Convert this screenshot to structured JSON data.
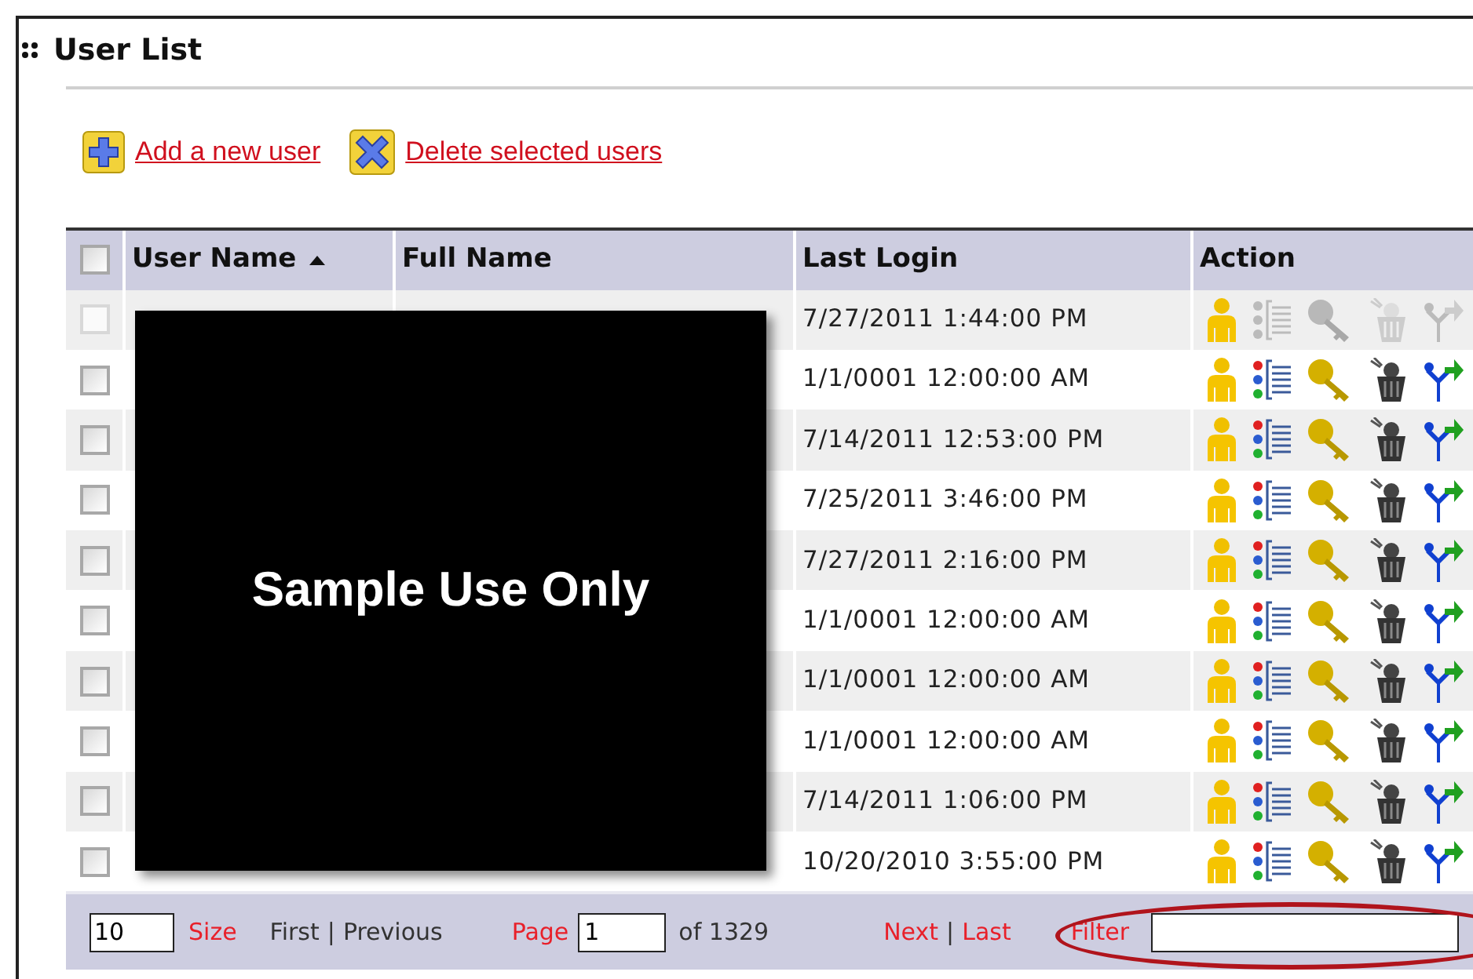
{
  "title": "User List",
  "actions": [
    {
      "kind": "add",
      "label": "Add a new user"
    },
    {
      "kind": "delete",
      "label": "Delete selected users"
    }
  ],
  "table": {
    "select_all": {
      "checked": false
    },
    "columns": [
      {
        "label": "User Name",
        "sorted_ascending": true
      },
      {
        "label": "Full Name",
        "sorted_ascending": false
      },
      {
        "label": "Last Login",
        "sorted_ascending": false
      },
      {
        "label": "Action",
        "sorted_ascending": false
      }
    ],
    "rows": [
      {
        "last_login": "7/27/2011 1:44:00 PM",
        "checked": false,
        "disabled": true
      },
      {
        "last_login": "1/1/0001 12:00:00 AM",
        "checked": false,
        "disabled": false
      },
      {
        "last_login": "7/14/2011 12:53:00 PM",
        "checked": false,
        "disabled": false
      },
      {
        "last_login": "7/25/2011 3:46:00 PM",
        "checked": false,
        "disabled": false
      },
      {
        "last_login": "7/27/2011 2:16:00 PM",
        "checked": false,
        "disabled": false
      },
      {
        "last_login": "1/1/0001 12:00:00 AM",
        "checked": false,
        "disabled": false
      },
      {
        "last_login": "1/1/0001 12:00:00 AM",
        "checked": false,
        "disabled": false
      },
      {
        "last_login": "1/1/0001 12:00:00 AM",
        "checked": false,
        "disabled": false
      },
      {
        "last_login": "7/14/2011 1:06:00 PM",
        "checked": false,
        "disabled": false
      },
      {
        "last_login": "10/20/2010 3:55:00 PM",
        "checked": false,
        "disabled": false
      }
    ]
  },
  "pager": {
    "size_value": "10",
    "size_label": "Size",
    "back_links": [
      {
        "label": "First",
        "disabled": true
      },
      {
        "label": "Previous",
        "disabled": true
      }
    ],
    "page_label": "Page",
    "page_value": "1",
    "page_total": "of 1329",
    "forward_links": [
      {
        "label": "Next",
        "disabled": false
      },
      {
        "label": "Last",
        "disabled": false
      }
    ],
    "separator": "|",
    "filter_label": "Filter"
  },
  "overlay": {
    "text": "Sample Use Only"
  }
}
